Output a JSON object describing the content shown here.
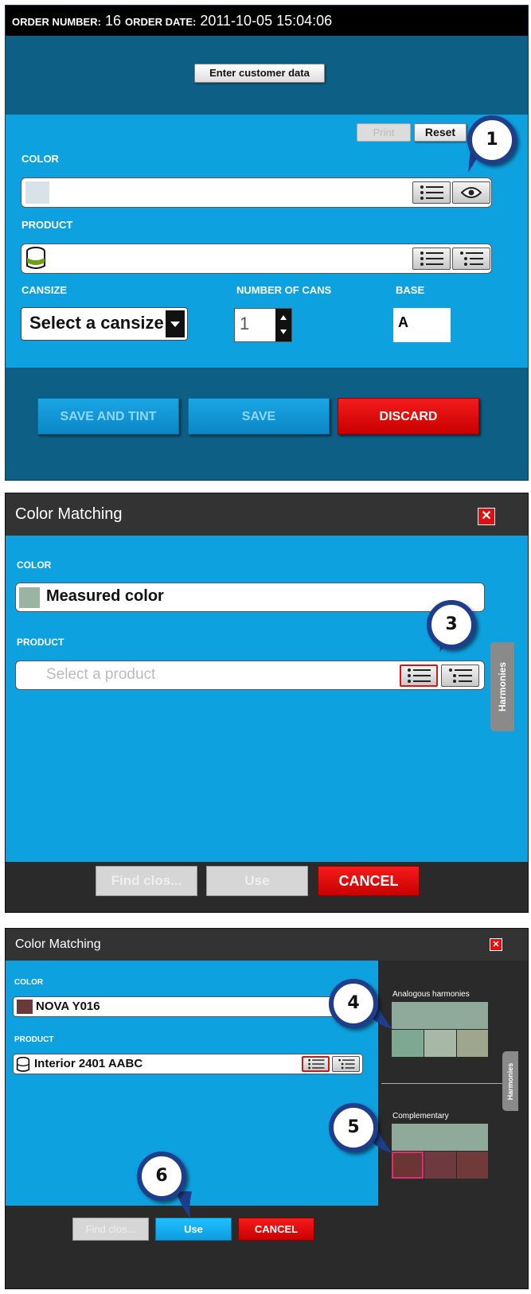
{
  "panel1": {
    "order_number_label": "ORDER NUMBER:",
    "order_number": "16",
    "order_date_label": "ORDER DATE:",
    "order_date": "2011-10-05 15:04:06",
    "enter_customer_button": "Enter customer data",
    "print_button": "Print",
    "reset_button": "Reset",
    "color_label": "COLOR",
    "product_label": "PRODUCT",
    "cansize_label": "CANSIZE",
    "number_of_cans_label": "NUMBER OF CANS",
    "base_label": "BASE",
    "cansize_select": "Select a cansize",
    "number_of_cans_value": "1",
    "base_value": "A",
    "save_and_tint_button": "SAVE AND TINT",
    "save_button": "SAVE",
    "discard_button": "DISCARD",
    "callout": "1"
  },
  "panel2": {
    "title": "Color Matching",
    "color_label": "COLOR",
    "color_value": "Measured color",
    "color_swatch": "#9bb3a3",
    "product_label": "PRODUCT",
    "product_placeholder": "Select a product",
    "harmonies_tab": "Harmonies",
    "find_button": "Find clos...",
    "use_button": "Use",
    "cancel_button": "CANCEL",
    "callout": "3"
  },
  "panel3": {
    "title": "Color Matching",
    "color_label": "COLOR",
    "color_value": "NOVA Y016",
    "color_swatch": "#6a3a3a",
    "product_label": "PRODUCT",
    "product_value": "Interior 2401 AABC",
    "analogous_label": "Analogous harmonies",
    "complementary_label": "Complementary",
    "harmonies_tab": "Harmonies",
    "find_button": "Find clos...",
    "use_button": "Use",
    "cancel_button": "CANCEL",
    "callout_4": "4",
    "callout_5": "5",
    "callout_6": "6",
    "analogous_colors": [
      "#8fa99a",
      "#7ea892",
      "#a7b8a6",
      "#9ea78d"
    ],
    "complementary_colors": [
      "#8fa99a",
      "#6b3535",
      "#6f3a3f",
      "#713a3a"
    ]
  },
  "colors": {
    "accent_blue": "#0ea1e0",
    "dark_header": "#000000",
    "discard_red": "#e01010"
  }
}
